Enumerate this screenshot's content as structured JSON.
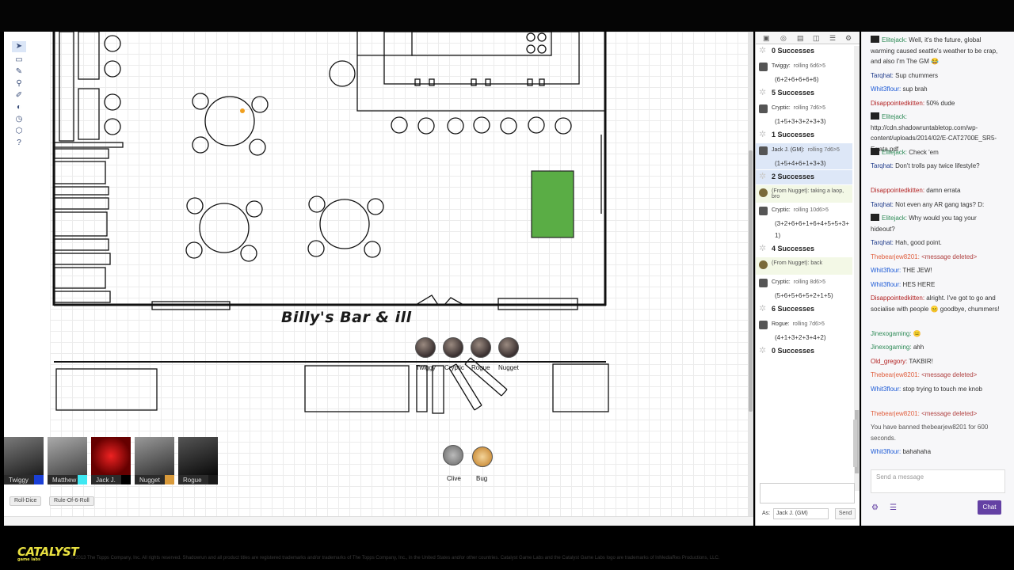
{
  "map": {
    "title": "Billy's Bar &  ill",
    "tokens": [
      "Twiggy",
      "Cryptic",
      "Rogue",
      "Nugget"
    ],
    "npcs": [
      "Clive",
      "Bug"
    ]
  },
  "players": [
    {
      "name": "Twiggy",
      "color": "#1a3fd6"
    },
    {
      "name": "Matthew W.",
      "color": "#3ee8f2"
    },
    {
      "name": "Jack J.",
      "color": "#000000"
    },
    {
      "name": "Nugget",
      "color": "#d99a3a"
    },
    {
      "name": "Rogue",
      "color": "#1a1a1a"
    }
  ],
  "macros": [
    "Roll-Dice",
    "Rule-Of-6-Roll"
  ],
  "roll_log": [
    {
      "type": "success",
      "text": "0 Successes"
    },
    {
      "type": "roll",
      "who": "Twiggy:",
      "cmd": "rolling 6d6>5",
      "dice": "(6+2+6+6+6+6)"
    },
    {
      "type": "success",
      "text": "5 Successes"
    },
    {
      "type": "roll",
      "who": "Cryptic:",
      "cmd": "rolling 7d6>5",
      "dice": "(1+5+3+3+2+3+3)"
    },
    {
      "type": "success",
      "text": "1 Successes"
    },
    {
      "type": "roll",
      "who": "Jack J. (GM):",
      "cmd": "rolling 7d6>5",
      "dice": "(1+5+4+6+1+3+3)"
    },
    {
      "type": "success",
      "text": "2 Successes"
    },
    {
      "type": "whisper",
      "text": "(From Nugget): taking a laop, bro"
    },
    {
      "type": "roll",
      "who": "Cryptic:",
      "cmd": "rolling 10d6>5",
      "dice": "(3+2+6+6+1+6+4+5+5+3+1)"
    },
    {
      "type": "success",
      "text": "4 Successes"
    },
    {
      "type": "whisper",
      "text": "(From Nugget): back"
    },
    {
      "type": "roll",
      "who": "Cryptic:",
      "cmd": "rolling 8d6>5",
      "dice": "(5+6+5+6+5+2+1+5)"
    },
    {
      "type": "success",
      "text": "6 Successes"
    },
    {
      "type": "roll",
      "who": "Rogue:",
      "cmd": "rolling 7d6>5",
      "dice": "(4+1+3+2+3+4+2)"
    },
    {
      "type": "success",
      "text": "0 Successes"
    }
  ],
  "roll_as": {
    "label": "As:",
    "value": "Jack J. (GM)",
    "send": "Send"
  },
  "chat": {
    "messages": [
      {
        "user": "Elitejack:",
        "color": "#2e8b57",
        "text": "Well, it's the future, global warming caused seattle's weather to be crap, and also I'm The GM 😂",
        "badge": true
      },
      {
        "user": "Tarqhat:",
        "color": "#1e3a8a",
        "text": "Sup chummers"
      },
      {
        "user": "Whit3flour:",
        "color": "#1e5bd6",
        "text": "sup brah"
      },
      {
        "user": "Disappointedkitten:",
        "color": "#b22222",
        "text": "50% dude"
      },
      {
        "user": "Elitejack:",
        "color": "#2e8b57",
        "text": "http://cdn.shadowruntabletop.com/wp-content/uploads/2014/02/E-CAT2700E_SR5-Errata.pdf",
        "badge": true
      },
      {
        "user": "Elitejack:",
        "color": "#2e8b57",
        "text": "Check 'em",
        "badge": true
      },
      {
        "user": "Tarqhat:",
        "color": "#1e3a8a",
        "text": "Don't trolls pay twice lifestyle?"
      },
      {
        "user": "Disappointedkitten:",
        "color": "#b22222",
        "text": "damn errata"
      },
      {
        "user": "Tarqhat:",
        "color": "#1e3a8a",
        "text": "Not even any AR gang tags? D:"
      },
      {
        "user": "Elitejack:",
        "color": "#2e8b57",
        "text": "Why would you tag your hideout?",
        "badge": true
      },
      {
        "user": "Tarqhat:",
        "color": "#1e3a8a",
        "text": "Hah, good point."
      },
      {
        "user": "Thebearjew8201:",
        "color": "#e06040",
        "text": "<message deleted>"
      },
      {
        "user": "Whit3flour:",
        "color": "#1e5bd6",
        "text": "THE JEW!"
      },
      {
        "user": "Whit3flour:",
        "color": "#1e5bd6",
        "text": "HES HERE"
      },
      {
        "user": "Disappointedkitten:",
        "color": "#b22222",
        "text": "alright. I've got to go and socialise with people 😐 goodbye, chummers!"
      },
      {
        "user": "Jinexogaming:",
        "color": "#2e8b57",
        "text": "😐"
      },
      {
        "user": "Jinexogaming:",
        "color": "#2e8b57",
        "text": "ahh"
      },
      {
        "user": "Old_gregory:",
        "color": "#b22222",
        "text": "TAKBIR!"
      },
      {
        "user": "Thebearjew8201:",
        "color": "#e06040",
        "text": "<message deleted>"
      },
      {
        "user": "Whit3flour:",
        "color": "#1e5bd6",
        "text": "stop trying to touch me knob"
      },
      {
        "user": "Thebearjew8201:",
        "color": "#e06040",
        "text": "<message deleted>"
      },
      {
        "user": "",
        "color": "#555555",
        "text": "You have banned thebearjew8201 for 600 seconds."
      },
      {
        "user": "Whit3flour:",
        "color": "#1e5bd6",
        "text": "bahahaha"
      }
    ],
    "placeholder": "Send a message",
    "send": "Chat"
  },
  "footer": {
    "logo": "CATALYST",
    "logo_sub": "game labs",
    "copyright": "© 2013 The Topps Company, Inc. All rights reserved. Shadowrun and all product titles are registered trademarks and/or trademarks of The Topps Company, Inc., in the United States and/or other countries. Catalyst Game Labs and the Catalyst Game Labs logo are trademarks of InMediaRes Productions, LLC."
  },
  "colors": {
    "accent": "#6441a4",
    "map_green": "#5aad45",
    "logo": "#e8e040"
  }
}
